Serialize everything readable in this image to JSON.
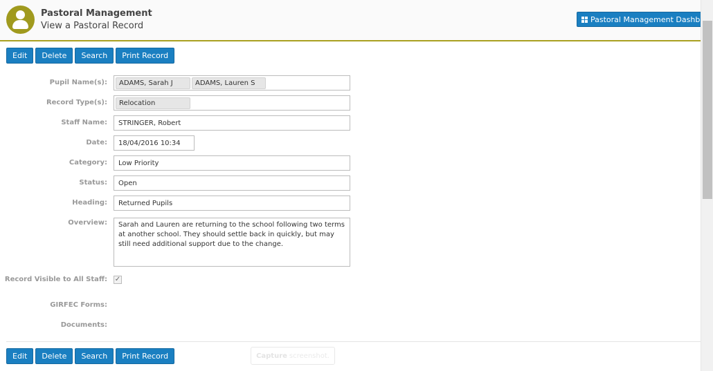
{
  "header": {
    "app_title": "Pastoral Management",
    "page_subtitle": "View a Pastoral Record",
    "dashboard_button": "Pastoral Management Dashboard",
    "accent_color": "#a09a1e"
  },
  "toolbar": {
    "edit": "Edit",
    "delete": "Delete",
    "search": "Search",
    "print": "Print Record"
  },
  "form": {
    "pupil_names_label": "Pupil Name(s):",
    "pupils": [
      "ADAMS, Sarah J",
      "ADAMS, Lauren S"
    ],
    "record_types_label": "Record Type(s):",
    "record_types": [
      "Relocation"
    ],
    "staff_name_label": "Staff Name:",
    "staff_name": "STRINGER, Robert",
    "date_label": "Date:",
    "date": "18/04/2016 10:34",
    "category_label": "Category:",
    "category": "Low Priority",
    "status_label": "Status:",
    "status": "Open",
    "heading_label": "Heading:",
    "heading": "Returned Pupils",
    "overview_label": "Overview:",
    "overview": "Sarah and Lauren are returning to the school following two terms at another school. They should settle back in quickly, but may still need additional support due to the change.",
    "visible_label": "Record Visible to All Staff:",
    "visible_checked": true,
    "girfec_label": "GIRFEC Forms:",
    "documents_label": "Documents:"
  },
  "capture": {
    "bold": "Capture",
    "rest": "screenshot."
  },
  "colors": {
    "button": "#1a7fc1",
    "header_rule": "#a9a020"
  }
}
